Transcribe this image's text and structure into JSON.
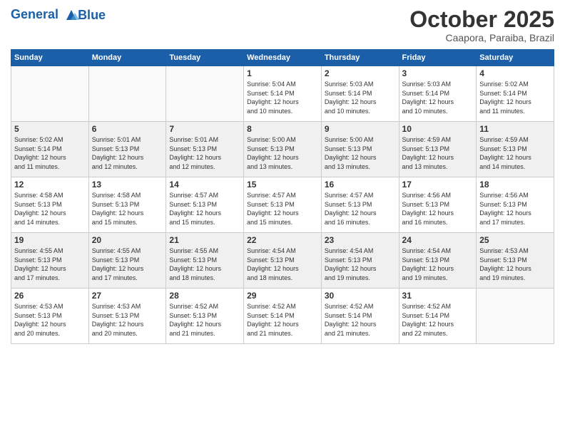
{
  "header": {
    "logo_line1": "General",
    "logo_line2": "Blue",
    "month": "October 2025",
    "location": "Caapora, Paraiba, Brazil"
  },
  "weekdays": [
    "Sunday",
    "Monday",
    "Tuesday",
    "Wednesday",
    "Thursday",
    "Friday",
    "Saturday"
  ],
  "weeks": [
    [
      {
        "day": "",
        "info": ""
      },
      {
        "day": "",
        "info": ""
      },
      {
        "day": "",
        "info": ""
      },
      {
        "day": "1",
        "info": "Sunrise: 5:04 AM\nSunset: 5:14 PM\nDaylight: 12 hours\nand 10 minutes."
      },
      {
        "day": "2",
        "info": "Sunrise: 5:03 AM\nSunset: 5:14 PM\nDaylight: 12 hours\nand 10 minutes."
      },
      {
        "day": "3",
        "info": "Sunrise: 5:03 AM\nSunset: 5:14 PM\nDaylight: 12 hours\nand 10 minutes."
      },
      {
        "day": "4",
        "info": "Sunrise: 5:02 AM\nSunset: 5:14 PM\nDaylight: 12 hours\nand 11 minutes."
      }
    ],
    [
      {
        "day": "5",
        "info": "Sunrise: 5:02 AM\nSunset: 5:14 PM\nDaylight: 12 hours\nand 11 minutes."
      },
      {
        "day": "6",
        "info": "Sunrise: 5:01 AM\nSunset: 5:13 PM\nDaylight: 12 hours\nand 12 minutes."
      },
      {
        "day": "7",
        "info": "Sunrise: 5:01 AM\nSunset: 5:13 PM\nDaylight: 12 hours\nand 12 minutes."
      },
      {
        "day": "8",
        "info": "Sunrise: 5:00 AM\nSunset: 5:13 PM\nDaylight: 12 hours\nand 13 minutes."
      },
      {
        "day": "9",
        "info": "Sunrise: 5:00 AM\nSunset: 5:13 PM\nDaylight: 12 hours\nand 13 minutes."
      },
      {
        "day": "10",
        "info": "Sunrise: 4:59 AM\nSunset: 5:13 PM\nDaylight: 12 hours\nand 13 minutes."
      },
      {
        "day": "11",
        "info": "Sunrise: 4:59 AM\nSunset: 5:13 PM\nDaylight: 12 hours\nand 14 minutes."
      }
    ],
    [
      {
        "day": "12",
        "info": "Sunrise: 4:58 AM\nSunset: 5:13 PM\nDaylight: 12 hours\nand 14 minutes."
      },
      {
        "day": "13",
        "info": "Sunrise: 4:58 AM\nSunset: 5:13 PM\nDaylight: 12 hours\nand 15 minutes."
      },
      {
        "day": "14",
        "info": "Sunrise: 4:57 AM\nSunset: 5:13 PM\nDaylight: 12 hours\nand 15 minutes."
      },
      {
        "day": "15",
        "info": "Sunrise: 4:57 AM\nSunset: 5:13 PM\nDaylight: 12 hours\nand 15 minutes."
      },
      {
        "day": "16",
        "info": "Sunrise: 4:57 AM\nSunset: 5:13 PM\nDaylight: 12 hours\nand 16 minutes."
      },
      {
        "day": "17",
        "info": "Sunrise: 4:56 AM\nSunset: 5:13 PM\nDaylight: 12 hours\nand 16 minutes."
      },
      {
        "day": "18",
        "info": "Sunrise: 4:56 AM\nSunset: 5:13 PM\nDaylight: 12 hours\nand 17 minutes."
      }
    ],
    [
      {
        "day": "19",
        "info": "Sunrise: 4:55 AM\nSunset: 5:13 PM\nDaylight: 12 hours\nand 17 minutes."
      },
      {
        "day": "20",
        "info": "Sunrise: 4:55 AM\nSunset: 5:13 PM\nDaylight: 12 hours\nand 17 minutes."
      },
      {
        "day": "21",
        "info": "Sunrise: 4:55 AM\nSunset: 5:13 PM\nDaylight: 12 hours\nand 18 minutes."
      },
      {
        "day": "22",
        "info": "Sunrise: 4:54 AM\nSunset: 5:13 PM\nDaylight: 12 hours\nand 18 minutes."
      },
      {
        "day": "23",
        "info": "Sunrise: 4:54 AM\nSunset: 5:13 PM\nDaylight: 12 hours\nand 19 minutes."
      },
      {
        "day": "24",
        "info": "Sunrise: 4:54 AM\nSunset: 5:13 PM\nDaylight: 12 hours\nand 19 minutes."
      },
      {
        "day": "25",
        "info": "Sunrise: 4:53 AM\nSunset: 5:13 PM\nDaylight: 12 hours\nand 19 minutes."
      }
    ],
    [
      {
        "day": "26",
        "info": "Sunrise: 4:53 AM\nSunset: 5:13 PM\nDaylight: 12 hours\nand 20 minutes."
      },
      {
        "day": "27",
        "info": "Sunrise: 4:53 AM\nSunset: 5:13 PM\nDaylight: 12 hours\nand 20 minutes."
      },
      {
        "day": "28",
        "info": "Sunrise: 4:52 AM\nSunset: 5:13 PM\nDaylight: 12 hours\nand 21 minutes."
      },
      {
        "day": "29",
        "info": "Sunrise: 4:52 AM\nSunset: 5:14 PM\nDaylight: 12 hours\nand 21 minutes."
      },
      {
        "day": "30",
        "info": "Sunrise: 4:52 AM\nSunset: 5:14 PM\nDaylight: 12 hours\nand 21 minutes."
      },
      {
        "day": "31",
        "info": "Sunrise: 4:52 AM\nSunset: 5:14 PM\nDaylight: 12 hours\nand 22 minutes."
      },
      {
        "day": "",
        "info": ""
      }
    ]
  ]
}
